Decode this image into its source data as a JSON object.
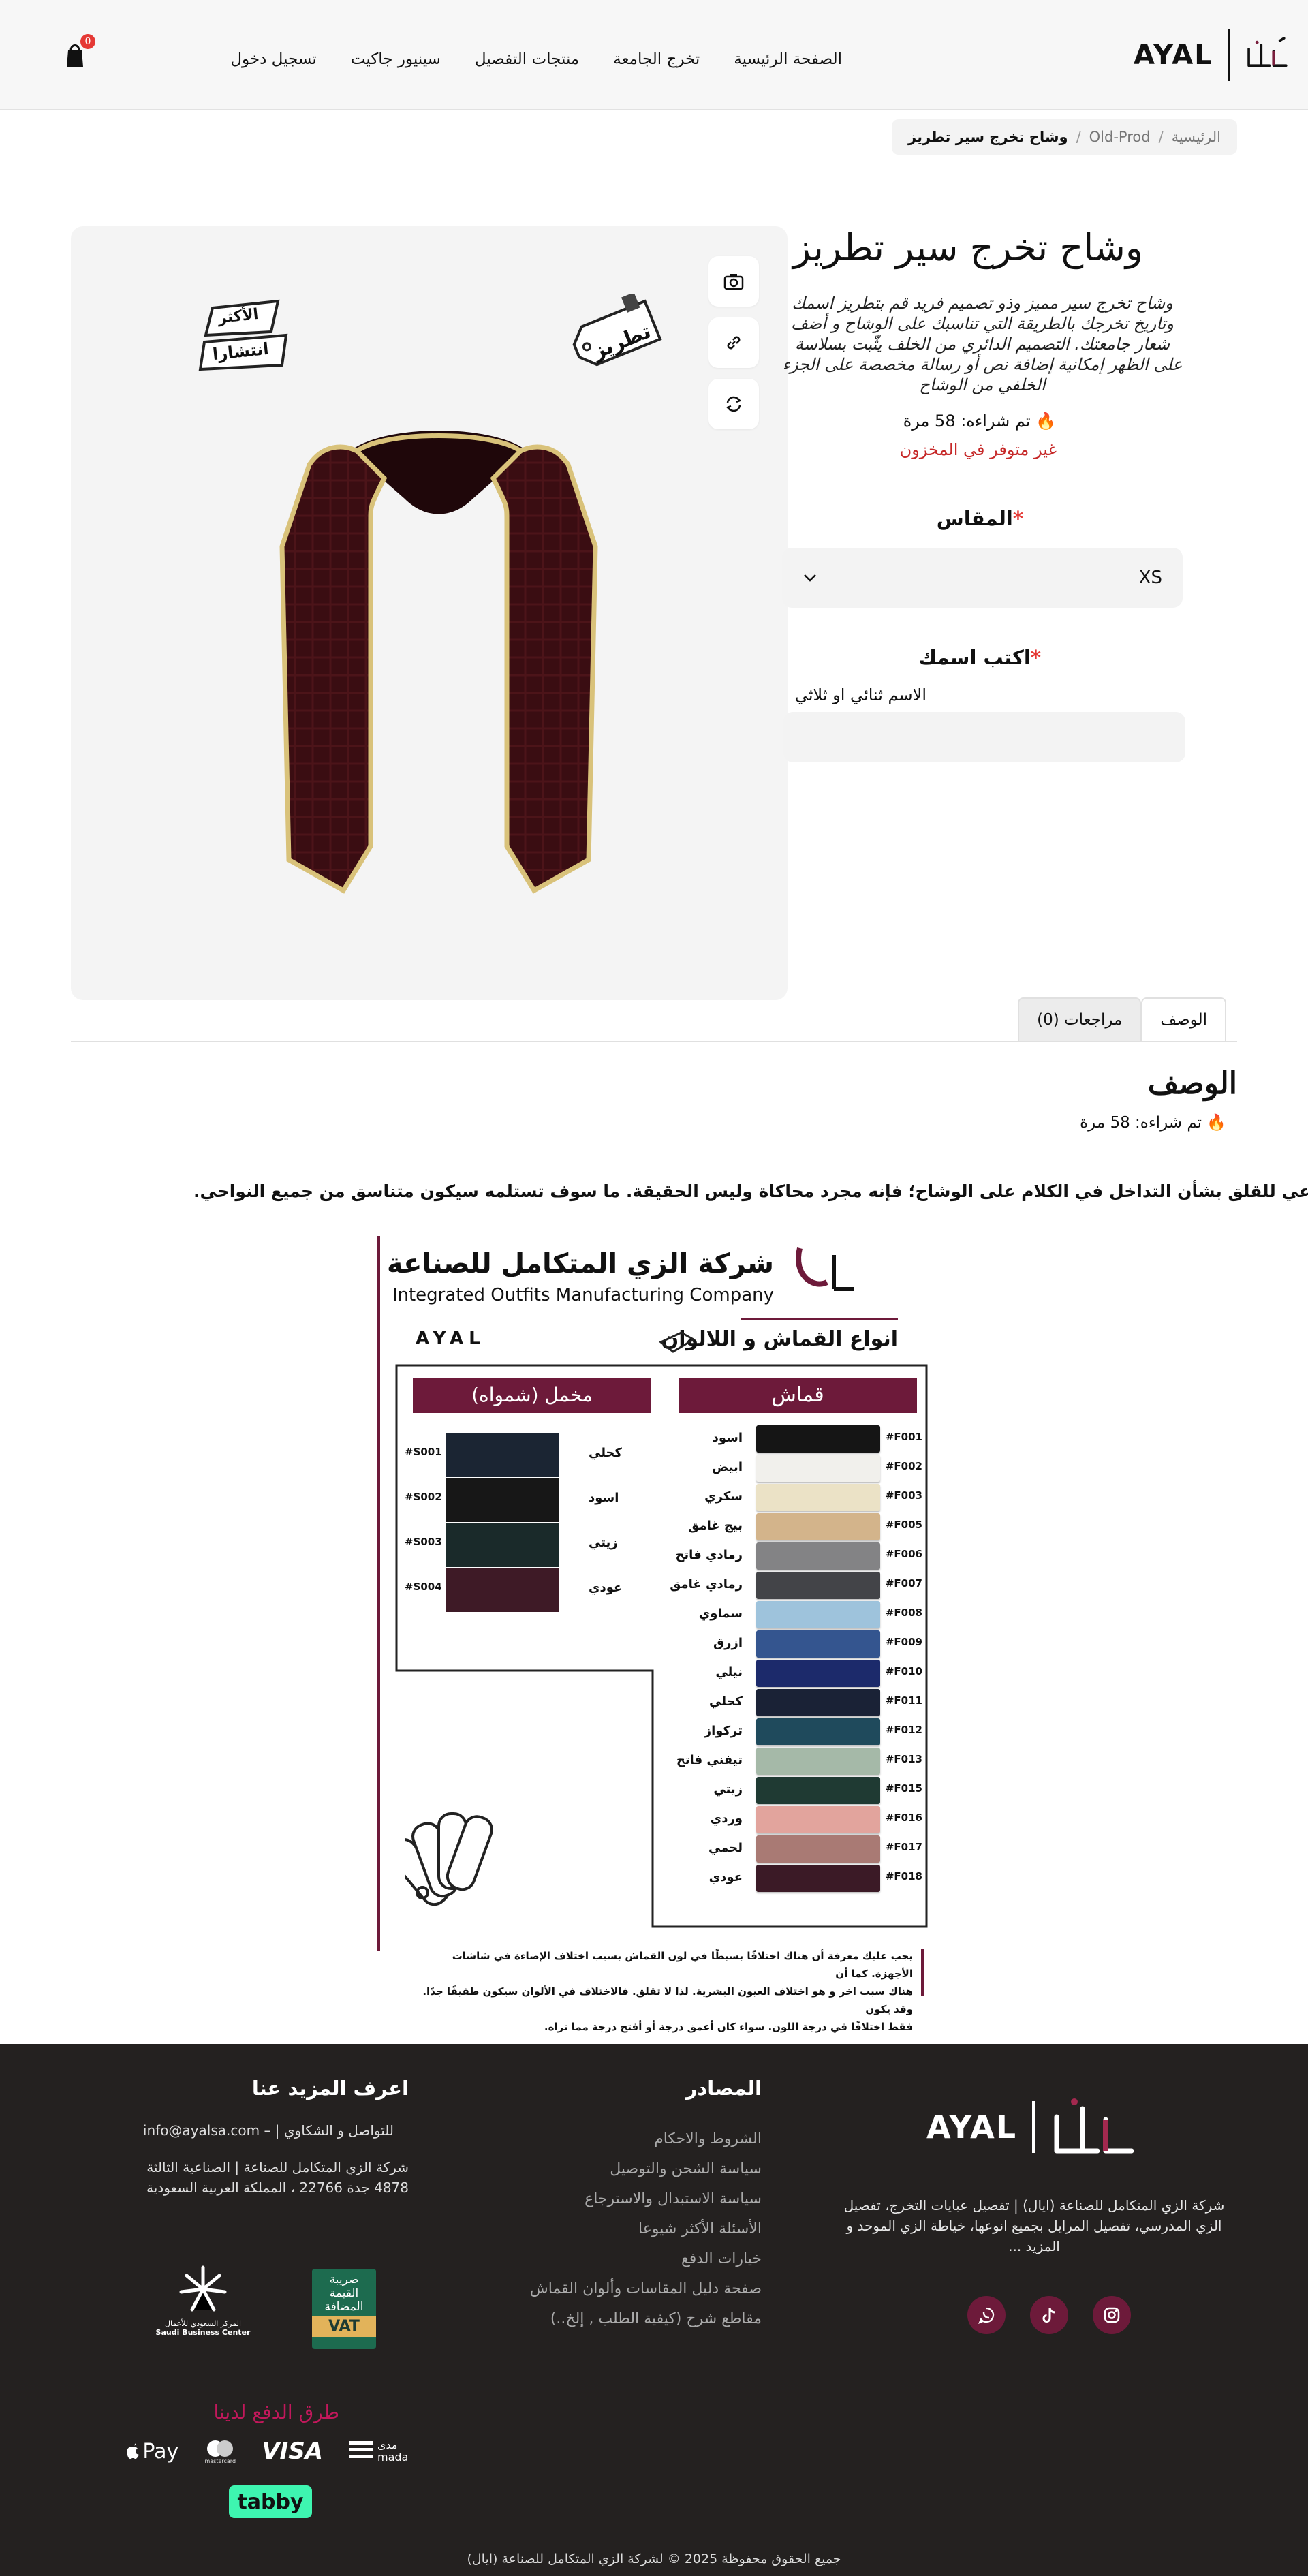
{
  "header": {
    "logo_text": "AYAL",
    "nav": [
      "الصفحة الرئيسية",
      "تخرج الجامعة",
      "منتجات التفصيل",
      "سينيور جاكيت",
      "تسجيل دخول"
    ],
    "cart_count": "0"
  },
  "breadcrumb": {
    "home": "الرئيسية",
    "sep1": "/",
    "category": "Old-Prod",
    "sep2": "/",
    "current": "وشاح تخرج سير تطريز"
  },
  "gallery": {
    "tag_most": [
      "الأكثر",
      "انتشارا"
    ],
    "tag_embroidery": "تطريز",
    "buttons": [
      "camera-icon",
      "link-icon",
      "refresh-icon"
    ]
  },
  "product": {
    "title": "وشاح تخرج سير تطريز",
    "description": "وشاح تخرج سير مميز وذو تصميم فريد قم بتطريز اسمك وتاريخ تخرجك بالطريقة التي تناسبك على الوشاح و أضف شعار جامعتك. التصميم الدائري من الخلف يثّبت بسلاسة على الظهر إمكانية إضافة نص أو رسالة مخصصة على الجزء الخلفي من الوشاح",
    "sold": "تم شراءه: 58 مرة",
    "stock": "غير متوفر في المخزون",
    "size_label": "المقاس",
    "size_required": "*",
    "size_value": "XS",
    "name_label": "اكتب اسمك",
    "name_required": "*",
    "name_hint": "الاسم ثنائي او ثلاثي"
  },
  "tabs": {
    "description": "الوصف",
    "reviews": "مراجعات (0)"
  },
  "description_section": {
    "title": "الوصف",
    "sold": "تم شراءه: 58 مرة",
    "note_stars": "**",
    "note": "لا داعي للقلق بشأن التداخل في الكلام على الوشاح؛ فإنه مجرد محاكاة وليس الحقيقة. ما سوف تستلمه سيكون متناسق من جميع النواحي."
  },
  "swatch": {
    "company_ar": "شركة الزي المتكامل للصناعة",
    "company_en": "Integrated Outfits Manufacturing Company",
    "brand": "AYAL",
    "heading": "انواع القماش و اللالوان",
    "fabric_title": "قماش",
    "velvet_title": "مخمل (شمواه)",
    "fabrics": [
      {
        "code": "#F001",
        "name": "اسود",
        "color": "#151515"
      },
      {
        "code": "#F002",
        "name": "ابيض",
        "color": "#f1f0ec"
      },
      {
        "code": "#F003",
        "name": "سكري",
        "color": "#ebe2c6"
      },
      {
        "code": "#F005",
        "name": "بيج غامق",
        "color": "#d3b48b"
      },
      {
        "code": "#F006",
        "name": "رمادي فاتح",
        "color": "#838385"
      },
      {
        "code": "#F007",
        "name": "رمادي غامق",
        "color": "#434448"
      },
      {
        "code": "#F008",
        "name": "سماوي",
        "color": "#9ec3dc"
      },
      {
        "code": "#F009",
        "name": "ازرق",
        "color": "#34558f"
      },
      {
        "code": "#F010",
        "name": "نيلي",
        "color": "#1c2a6b"
      },
      {
        "code": "#F011",
        "name": "كحلي",
        "color": "#1a2236"
      },
      {
        "code": "#F012",
        "name": "تركواز",
        "color": "#1f4a5c"
      },
      {
        "code": "#F013",
        "name": "تيفني فاتح",
        "color": "#a5b9a8"
      },
      {
        "code": "#F015",
        "name": "زيتي",
        "color": "#1f3a33"
      },
      {
        "code": "#F016",
        "name": "وردي",
        "color": "#e2a49d"
      },
      {
        "code": "#F017",
        "name": "لحمي",
        "color": "#a97a74"
      },
      {
        "code": "#F018",
        "name": "عودي",
        "color": "#3b1a26"
      }
    ],
    "velvets": [
      {
        "code": "#S001",
        "name": "كحلي",
        "color": "#1b2533"
      },
      {
        "code": "#S002",
        "name": "اسود",
        "color": "#171717"
      },
      {
        "code": "#S003",
        "name": "زيتي",
        "color": "#1a2a2a"
      },
      {
        "code": "#S004",
        "name": "عودي",
        "color": "#3e1a26"
      }
    ],
    "disclaimer": [
      "يجب عليك معرفة أن هناك اختلافًا بسيطًا في لون القماش بسبب اختلاف الإضاءة في شاشات الأجهزة. كما أن",
      "هناك سبب اخر و هو اختلاف العيون البشرية. لذا لا تقلق. فالاختلاف في الألوان سيكون طفيفًا جدًا. وقد يكون",
      "فقط اختلافًا في درجة اللون. سواء كان أعمق درجة أو أفتح درجة مما تراه."
    ]
  },
  "footer": {
    "about": "شركة الزي المتكامل للصناعة (ايال) | تفصيل عبايات التخرج، تفصيل الزي المدرسي، تفصيل المرايل بجميع انوعها، خياطة الزي الموحد و المزيد ...",
    "resources_title": "المصادر",
    "resources": [
      "الشروط والاحكام",
      "سياسة الشحن والتوصيل",
      "سياسة الاستبدال والاسترجاع",
      "الأسئلة الأكثر شيوعا",
      "خيارات الدفع",
      "صفحة دليل المقاسات وألوان القماش",
      "مقاطع شرح (كيفية الطلب , إلخ..)"
    ],
    "more_title": "اعرف المزيد عنا",
    "contact_email": "للتواصل و الشكاوي | – info@ayalsa.com",
    "address1": "شركة الزي المتكامل للصناعة | الصناعية الثالثة",
    "address2": "4878 جدة 22766 ، المملكة العربية السعودية",
    "vat_text": [
      "ضريبة",
      "القيمة",
      "المضافة",
      "VAT"
    ],
    "sbc_text": [
      "المركز السعودي للأعمال",
      "Saudi Business Center"
    ],
    "payment_title": "طرق الدفع لدينا",
    "payments": [
      "Pay",
      "mastercard",
      "VISA",
      "مدى mada"
    ],
    "tabby": "tabby",
    "copyright": "جميع الحقوق محفوظة 2025 © لشركة الزي المتكامل للصناعة (ايال)"
  }
}
